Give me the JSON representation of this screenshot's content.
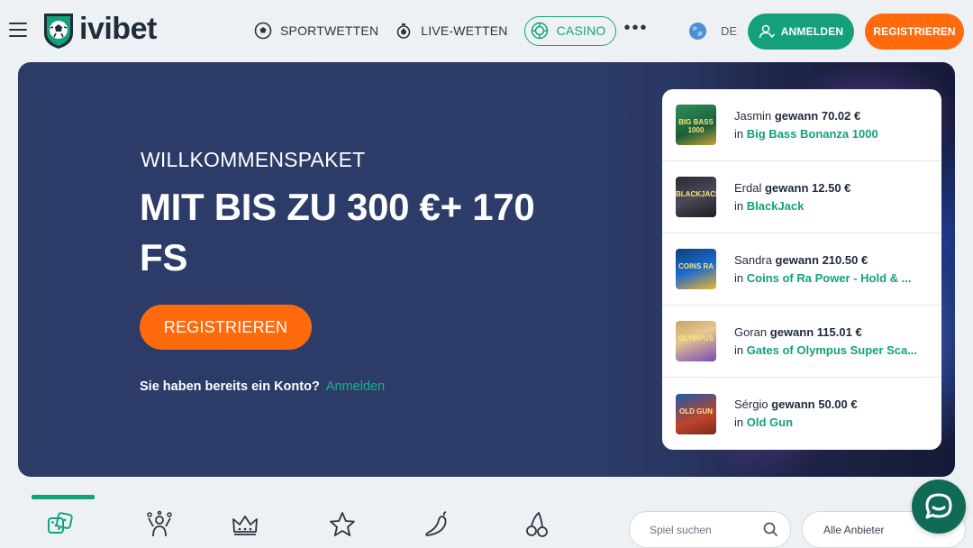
{
  "header": {
    "logo_text": "ivibet",
    "nav": [
      {
        "label": "SPORTWETTEN",
        "icon": "soccer-ball-icon"
      },
      {
        "label": "LIVE-WETTEN",
        "icon": "stopwatch-icon"
      },
      {
        "label": "CASINO",
        "icon": "roulette-icon",
        "active": true
      }
    ],
    "more_label": "•••",
    "language": "DE",
    "login_label": "ANMELDEN",
    "register_label": "REGISTRIEREN"
  },
  "hero": {
    "subtitle": "WILLKOMMENSPAKET",
    "title": "MIT BIS ZU 300 €+ 170 FS",
    "register_button": "REGISTRIEREN",
    "account_question": "Sie haben bereits ein Konto?",
    "account_link": "Anmelden"
  },
  "winners": [
    {
      "name": "Jasmin",
      "action": "gewann",
      "amount": "70.02 €",
      "in": "in",
      "game": "Big Bass Bonanza 1000",
      "thumb": "BIG BASS 1000"
    },
    {
      "name": "Erdal",
      "action": "gewann",
      "amount": "12.50 €",
      "in": "in",
      "game": "BlackJack",
      "thumb": "BLACKJACK"
    },
    {
      "name": "Sandra",
      "action": "gewann",
      "amount": "210.50 €",
      "in": "in",
      "game": "Coins of Ra Power - Hold & ...",
      "thumb": "COINS RA"
    },
    {
      "name": "Goran",
      "action": "gewann",
      "amount": "115.01 €",
      "in": "in",
      "game": "Gates of Olympus Super Sca...",
      "thumb": "OLYMPUS"
    },
    {
      "name": "Sérgio",
      "action": "gewann",
      "amount": "50.00 €",
      "in": "in",
      "game": "Old Gun",
      "thumb": "OLD GUN"
    }
  ],
  "categories": [
    {
      "name": "dice-icon",
      "active": true
    },
    {
      "name": "jackpot-winner-icon"
    },
    {
      "name": "crown-icon"
    },
    {
      "name": "star-icon"
    },
    {
      "name": "chili-pepper-icon"
    },
    {
      "name": "cherries-icon"
    }
  ],
  "search": {
    "placeholder": "Spiel suchen"
  },
  "provider": {
    "label": "Alle Anbieter"
  },
  "colors": {
    "brand_green": "#14a07b",
    "brand_orange": "#ff6a0d",
    "hero_bg": "#2c3b67"
  }
}
